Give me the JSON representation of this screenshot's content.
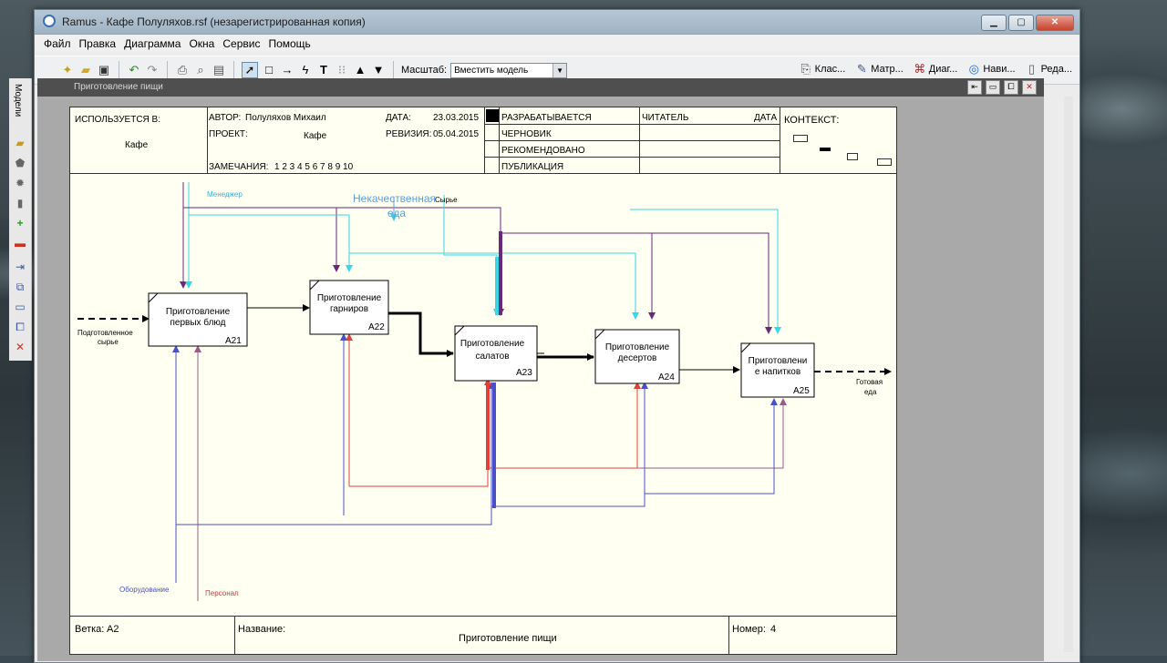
{
  "window": {
    "title": "Ramus - Кафе  Полуляхов.rsf (незарегистрированная копия)",
    "min_label": "▁",
    "max_label": "▢",
    "close_label": "✕"
  },
  "menu": [
    "Файл",
    "Правка",
    "Диаграмма",
    "Окна",
    "Сервис",
    "Помощь"
  ],
  "toolbar": {
    "zoom_label": "Масштаб:",
    "zoom_value": "Вместить модель",
    "right_tools": [
      "Клас...",
      "Матр...",
      "Диаг...",
      "Нави...",
      "Реда..."
    ]
  },
  "left_panel": {
    "label": "Модели"
  },
  "document": {
    "title": "Приготовление пищи"
  },
  "header": {
    "used_in_label": "ИСПОЛЬЗУЕТСЯ В:",
    "used_in_value": "Кафе",
    "author_label": "АВТОР:",
    "author_value": "Полуляхов Михаил",
    "project_label": "ПРОЕКТ:",
    "project_value": "Кафе",
    "date_label": "ДАТА:",
    "date_value": "23.03.2015",
    "revision_label": "РЕВИЗИЯ:",
    "revision_value": "05.04.2015",
    "notes_label": "ЗАМЕЧАНИЯ:",
    "notes_value": "1  2  3  4  5  6  7  8  9  10",
    "status": [
      "РАЗРАБАТЫВАЕТСЯ",
      "ЧЕРНОВИК",
      "РЕКОМЕНДОВАНО",
      "ПУБЛИКАЦИЯ"
    ],
    "reader_label": "ЧИТАТЕЛЬ",
    "reader_date_label": "ДАТА",
    "context_label": "КОНТЕКСТ:"
  },
  "footer": {
    "node_label": "Ветка:",
    "node_value": "A2",
    "name_label": "Название:",
    "name_value": "Приготовление пищи",
    "number_label": "Номер:",
    "number_value": "4"
  },
  "diagram": {
    "boxes": [
      {
        "id": "A21",
        "lines": [
          "Приготовление",
          "первых блюд"
        ]
      },
      {
        "id": "A22",
        "lines": [
          "Приготовление",
          "гарниров"
        ]
      },
      {
        "id": "A23",
        "lines": [
          "Приготовление",
          "салатов"
        ]
      },
      {
        "id": "A24",
        "lines": [
          "Приготовление",
          "десертов"
        ]
      },
      {
        "id": "A25",
        "lines": [
          "Приготовлени",
          "е напитков"
        ]
      }
    ],
    "labels": {
      "input": [
        "Подготовленное",
        "сырье"
      ],
      "output": [
        "Готовая",
        "еда"
      ],
      "manager": "Менеджер",
      "bad_food": [
        "Некачественная",
        "еда"
      ],
      "raw": "Сырье",
      "equipment": "Оборудование",
      "staff": "Персонал"
    },
    "colors": {
      "purple": "#6a2a7a",
      "cyan": "#38d6e6",
      "red": "#e0403a",
      "blue": "#4a50c8",
      "mauve": "#9a5a8a",
      "black": "#000000",
      "lightblue": "#5aa0e0"
    }
  }
}
